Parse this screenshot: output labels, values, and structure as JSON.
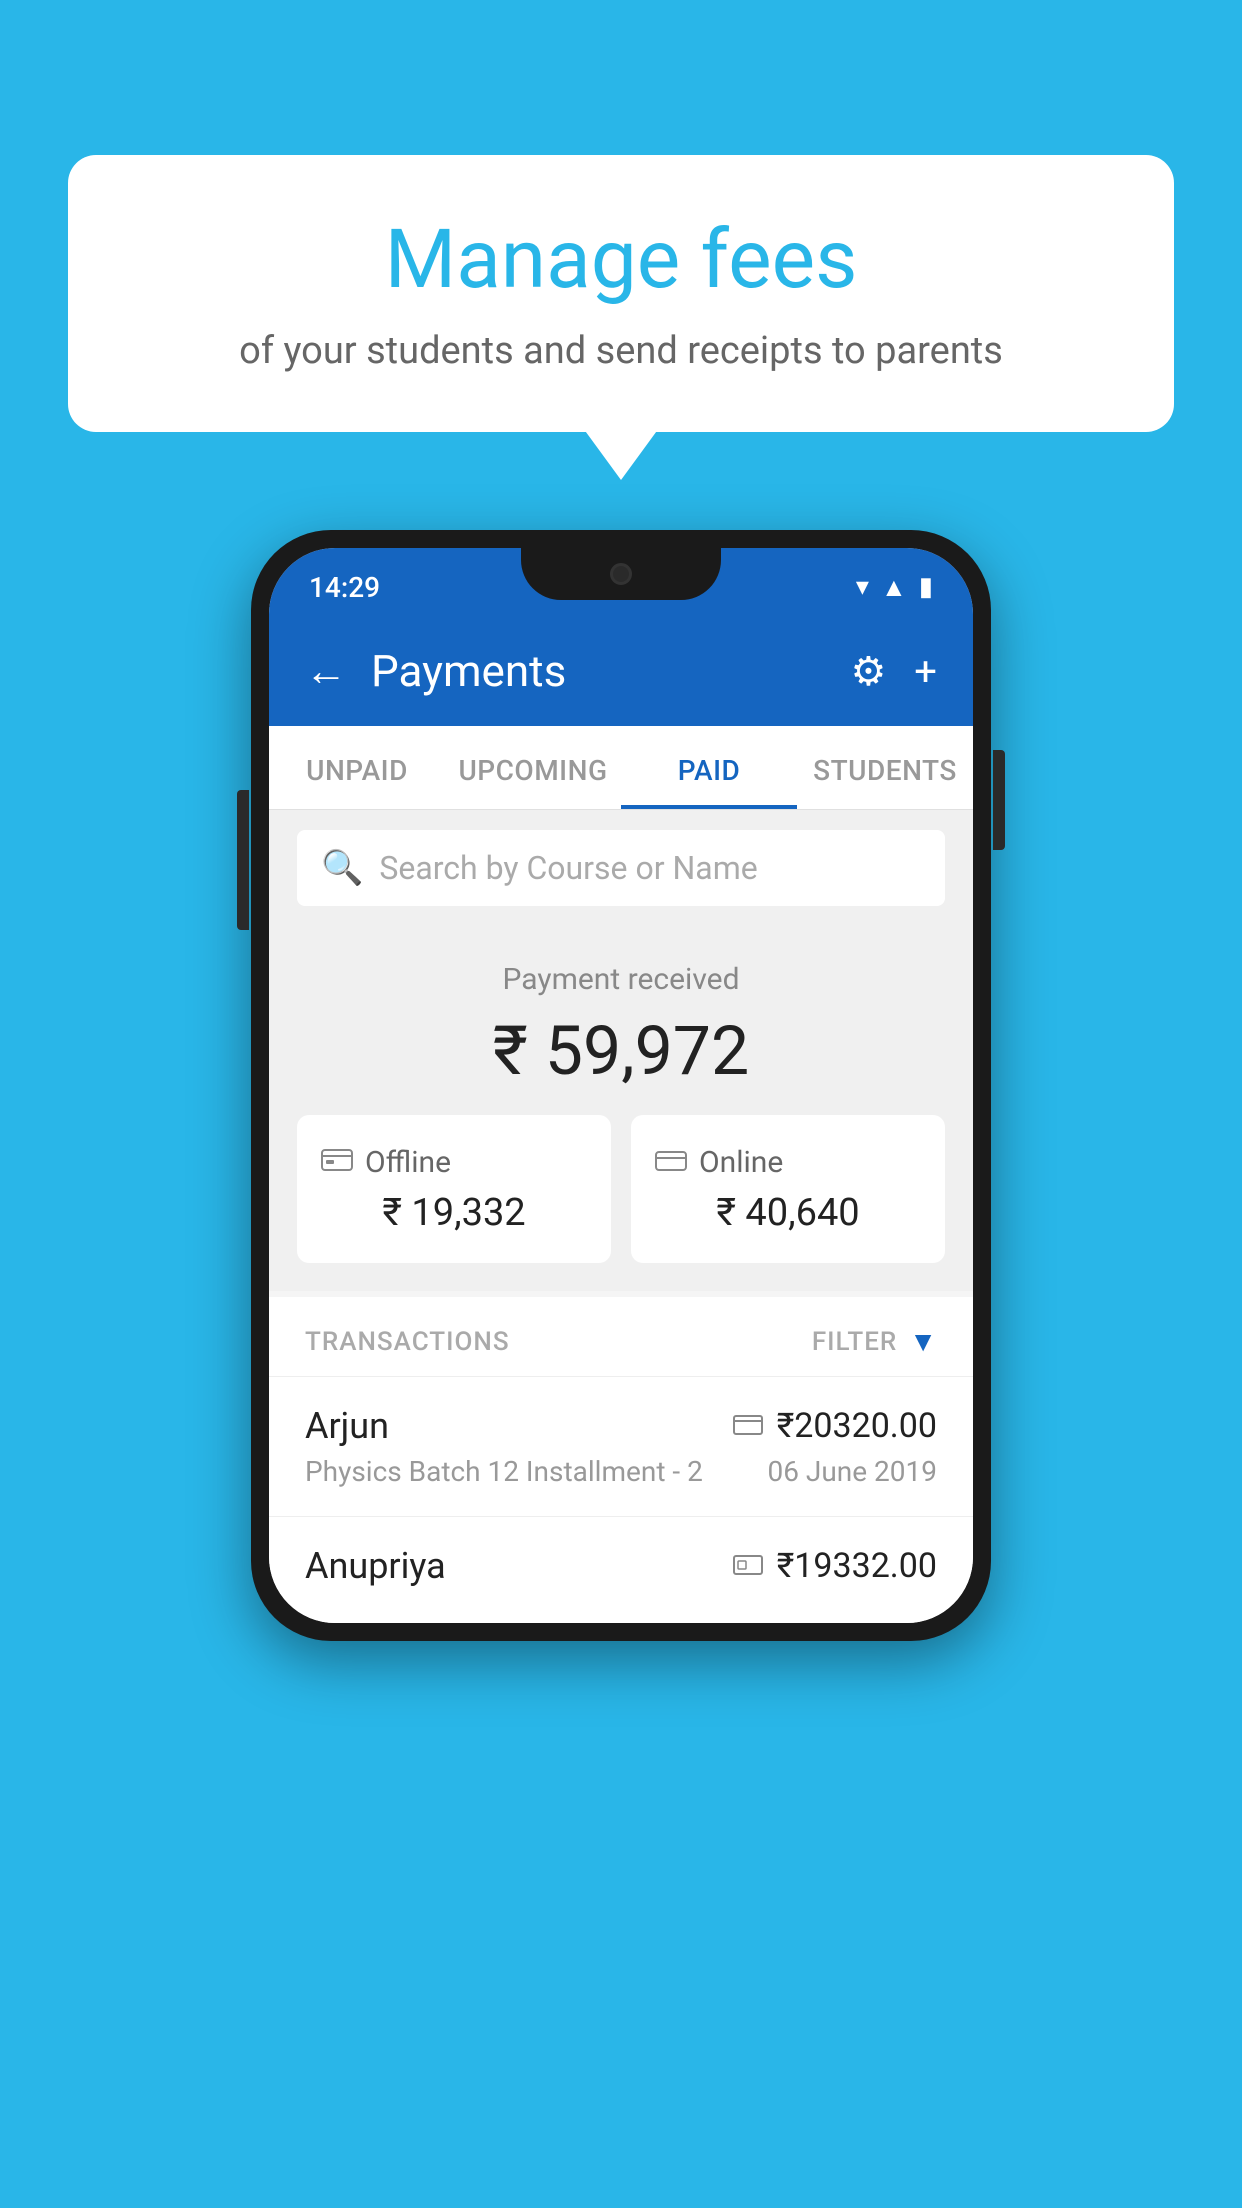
{
  "background_color": "#29b6e8",
  "bubble": {
    "title": "Manage fees",
    "subtitle": "of your students and send receipts to parents"
  },
  "status_bar": {
    "time": "14:29",
    "icons": [
      "wifi",
      "signal",
      "battery"
    ]
  },
  "header": {
    "title": "Payments",
    "back_label": "←",
    "settings_label": "⚙",
    "add_label": "+"
  },
  "tabs": [
    {
      "label": "UNPAID",
      "active": false
    },
    {
      "label": "UPCOMING",
      "active": false
    },
    {
      "label": "PAID",
      "active": true
    },
    {
      "label": "STUDENTS",
      "active": false
    }
  ],
  "search": {
    "placeholder": "Search by Course or Name"
  },
  "payment": {
    "label": "Payment received",
    "amount": "₹ 59,972",
    "offline": {
      "icon": "💳",
      "label": "Offline",
      "amount": "₹ 19,332"
    },
    "online": {
      "icon": "💳",
      "label": "Online",
      "amount": "₹ 40,640"
    }
  },
  "transactions": {
    "label": "TRANSACTIONS",
    "filter_label": "FILTER",
    "rows": [
      {
        "name": "Arjun",
        "icon": "card",
        "amount": "₹20320.00",
        "desc": "Physics Batch 12 Installment - 2",
        "date": "06 June 2019"
      },
      {
        "name": "Anupriya",
        "icon": "cash",
        "amount": "₹19332.00",
        "desc": "",
        "date": ""
      }
    ]
  }
}
